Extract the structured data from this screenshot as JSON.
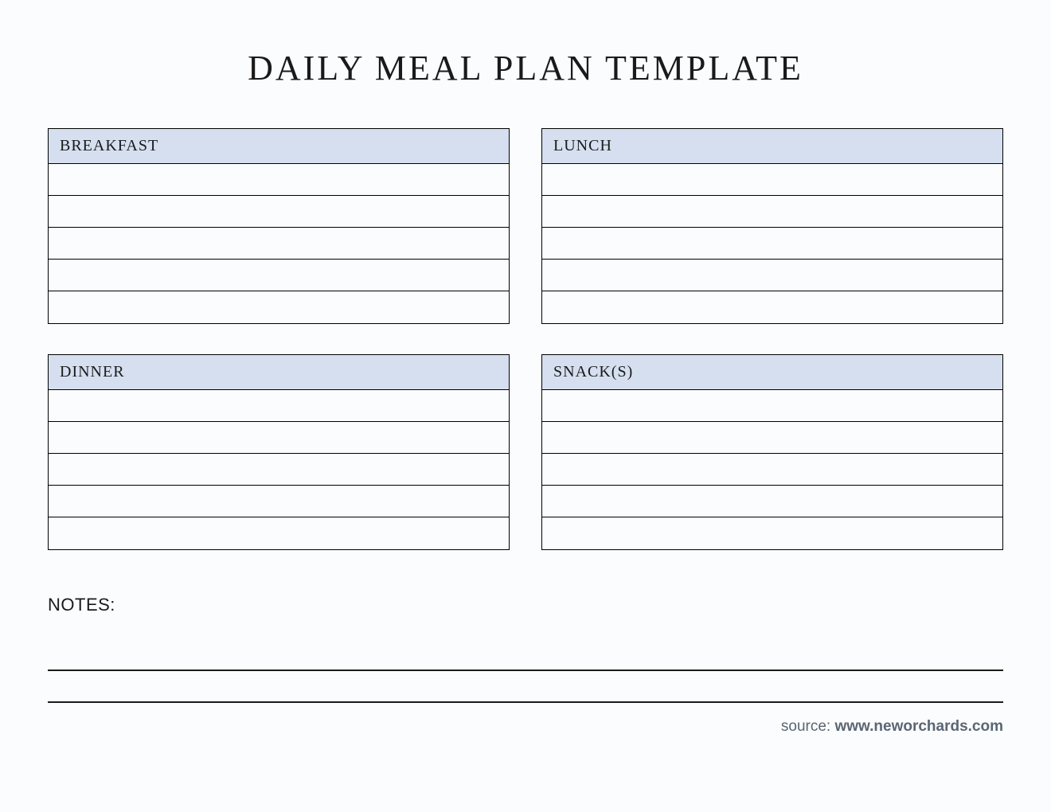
{
  "title": "DAILY MEAL PLAN TEMPLATE",
  "meals": {
    "breakfast": {
      "label": "BREAKFAST",
      "rows": [
        "",
        "",
        "",
        "",
        ""
      ]
    },
    "lunch": {
      "label": "LUNCH",
      "rows": [
        "",
        "",
        "",
        "",
        ""
      ]
    },
    "dinner": {
      "label": "DINNER",
      "rows": [
        "",
        "",
        "",
        "",
        ""
      ]
    },
    "snacks": {
      "label": "SNACK(S)",
      "rows": [
        "",
        "",
        "",
        "",
        ""
      ]
    }
  },
  "notes": {
    "label": "NOTES:",
    "lines": [
      "",
      ""
    ]
  },
  "source": {
    "prefix": "source: ",
    "url": "www.neworchards.com"
  },
  "colors": {
    "header_bg": "#d5dfef",
    "page_bg": "#fbfcfd"
  }
}
